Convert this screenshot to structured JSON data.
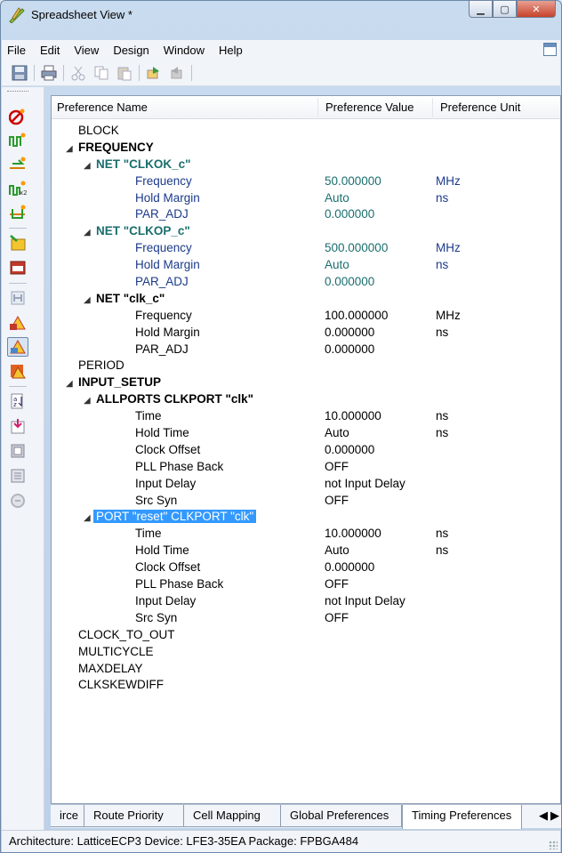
{
  "window": {
    "title": "Spreadsheet View *"
  },
  "menu": [
    "File",
    "Edit",
    "View",
    "Design",
    "Window",
    "Help"
  ],
  "grid": {
    "columns": [
      "Preference Name",
      "Preference Value",
      "Preference Unit"
    ],
    "rows": [
      {
        "name": "BLOCK",
        "value": "",
        "unit": "",
        "indent": 0,
        "style": "dk",
        "bold": false,
        "arrow": false
      },
      {
        "name": "FREQUENCY",
        "value": "",
        "unit": "",
        "indent": 0,
        "style": "dk",
        "bold": true,
        "arrow": true
      },
      {
        "name": "NET \"CLKOK_c\"",
        "value": "",
        "unit": "",
        "indent": 1,
        "style": "teal",
        "bold": true,
        "arrow": true
      },
      {
        "name": "Frequency",
        "value": "50.000000",
        "unit": "MHz",
        "indent": 2,
        "style": "teal",
        "bold": false,
        "arrow": false
      },
      {
        "name": "Hold Margin",
        "value": "Auto",
        "unit": "ns",
        "indent": 2,
        "style": "teal",
        "bold": false,
        "arrow": false
      },
      {
        "name": "PAR_ADJ",
        "value": "0.000000",
        "unit": "",
        "indent": 2,
        "style": "teal",
        "bold": false,
        "arrow": false
      },
      {
        "name": "NET \"CLKOP_c\"",
        "value": "",
        "unit": "",
        "indent": 1,
        "style": "teal",
        "bold": true,
        "arrow": true
      },
      {
        "name": "Frequency",
        "value": "500.000000",
        "unit": "MHz",
        "indent": 2,
        "style": "teal",
        "bold": false,
        "arrow": false
      },
      {
        "name": "Hold Margin",
        "value": "Auto",
        "unit": "ns",
        "indent": 2,
        "style": "teal",
        "bold": false,
        "arrow": false
      },
      {
        "name": "PAR_ADJ",
        "value": "0.000000",
        "unit": "",
        "indent": 2,
        "style": "teal",
        "bold": false,
        "arrow": false
      },
      {
        "name": "NET \"clk_c\"",
        "value": "",
        "unit": "",
        "indent": 1,
        "style": "dk",
        "bold": true,
        "arrow": true
      },
      {
        "name": "Frequency",
        "value": "100.000000",
        "unit": "MHz",
        "indent": 2,
        "style": "dk",
        "bold": false,
        "arrow": false
      },
      {
        "name": "Hold Margin",
        "value": "0.000000",
        "unit": "ns",
        "indent": 2,
        "style": "dk",
        "bold": false,
        "arrow": false
      },
      {
        "name": "PAR_ADJ",
        "value": "0.000000",
        "unit": "",
        "indent": 2,
        "style": "dk",
        "bold": false,
        "arrow": false
      },
      {
        "name": "PERIOD",
        "value": "",
        "unit": "",
        "indent": 0,
        "style": "dk",
        "bold": false,
        "arrow": false
      },
      {
        "name": "INPUT_SETUP",
        "value": "",
        "unit": "",
        "indent": 0,
        "style": "dk",
        "bold": true,
        "arrow": true
      },
      {
        "name": "ALLPORTS CLKPORT \"clk\"",
        "value": "",
        "unit": "",
        "indent": 1,
        "style": "dk",
        "bold": true,
        "arrow": true
      },
      {
        "name": "Time",
        "value": "10.000000",
        "unit": "ns",
        "indent": 2,
        "style": "dk",
        "bold": false,
        "arrow": false
      },
      {
        "name": "Hold Time",
        "value": "Auto",
        "unit": "ns",
        "indent": 2,
        "style": "dk",
        "bold": false,
        "arrow": false
      },
      {
        "name": "Clock Offset",
        "value": "0.000000",
        "unit": "",
        "indent": 2,
        "style": "dk",
        "bold": false,
        "arrow": false
      },
      {
        "name": "PLL Phase Back",
        "value": "OFF",
        "unit": "",
        "indent": 2,
        "style": "dk",
        "bold": false,
        "arrow": false
      },
      {
        "name": "Input Delay",
        "value": "not Input Delay",
        "unit": "",
        "indent": 2,
        "style": "dk",
        "bold": false,
        "arrow": false
      },
      {
        "name": "Src Syn",
        "value": "OFF",
        "unit": "",
        "indent": 2,
        "style": "dk",
        "bold": false,
        "arrow": false
      },
      {
        "name": "PORT \"reset\" CLKPORT \"clk\"",
        "value": "",
        "unit": "",
        "indent": 1,
        "style": "dk",
        "bold": false,
        "arrow": true,
        "selected": true
      },
      {
        "name": "Time",
        "value": "10.000000",
        "unit": "ns",
        "indent": 2,
        "style": "dk",
        "bold": false,
        "arrow": false
      },
      {
        "name": "Hold Time",
        "value": "Auto",
        "unit": "ns",
        "indent": 2,
        "style": "dk",
        "bold": false,
        "arrow": false
      },
      {
        "name": "Clock Offset",
        "value": "0.000000",
        "unit": "",
        "indent": 2,
        "style": "dk",
        "bold": false,
        "arrow": false
      },
      {
        "name": "PLL Phase Back",
        "value": "OFF",
        "unit": "",
        "indent": 2,
        "style": "dk",
        "bold": false,
        "arrow": false
      },
      {
        "name": "Input Delay",
        "value": "not Input Delay",
        "unit": "",
        "indent": 2,
        "style": "dk",
        "bold": false,
        "arrow": false
      },
      {
        "name": "Src Syn",
        "value": "OFF",
        "unit": "",
        "indent": 2,
        "style": "dk",
        "bold": false,
        "arrow": false
      },
      {
        "name": "CLOCK_TO_OUT",
        "value": "",
        "unit": "",
        "indent": 0,
        "style": "dk",
        "bold": false,
        "arrow": false
      },
      {
        "name": "MULTICYCLE",
        "value": "",
        "unit": "",
        "indent": 0,
        "style": "dk",
        "bold": false,
        "arrow": false
      },
      {
        "name": "MAXDELAY",
        "value": "",
        "unit": "",
        "indent": 0,
        "style": "dk",
        "bold": false,
        "arrow": false
      },
      {
        "name": "CLKSKEWDIFF",
        "value": "",
        "unit": "",
        "indent": 0,
        "style": "dk",
        "bold": false,
        "arrow": false
      }
    ]
  },
  "tabs": [
    {
      "label": "irce",
      "active": false
    },
    {
      "label": "Route Priority",
      "active": false
    },
    {
      "label": "Cell Mapping",
      "active": false
    },
    {
      "label": "Global Preferences",
      "active": false
    },
    {
      "label": "Timing Preferences",
      "active": true
    }
  ],
  "status": "Architecture: LatticeECP3  Device: LFE3-35EA  Package: FPBGA484"
}
